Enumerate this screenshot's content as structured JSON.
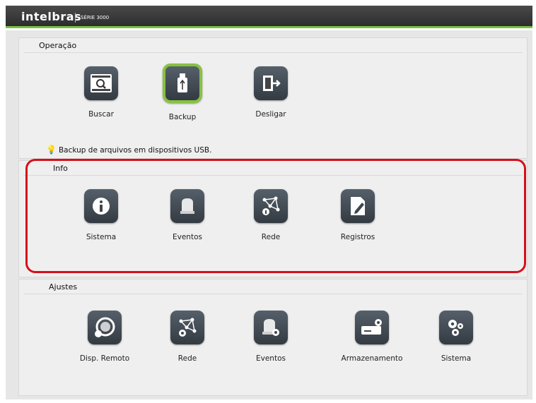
{
  "header": {
    "brand": "intelbras",
    "series": "SÉRIE 3000"
  },
  "operacao": {
    "title": "Operação",
    "items": [
      {
        "label": "Buscar",
        "icon": "search-video-icon"
      },
      {
        "label": "Backup",
        "icon": "usb-drive-icon",
        "selected": true
      },
      {
        "label": "Desligar",
        "icon": "exit-door-icon"
      }
    ],
    "hint": "Backup de arquivos em dispositivos USB."
  },
  "info": {
    "title": "Info",
    "items": [
      {
        "label": "Sistema",
        "icon": "info-icon"
      },
      {
        "label": "Eventos",
        "icon": "alarm-light-icon"
      },
      {
        "label": "Rede",
        "icon": "network-info-icon"
      },
      {
        "label": "Registros",
        "icon": "log-edit-icon"
      }
    ]
  },
  "ajustes": {
    "title": "Ajustes",
    "items": [
      {
        "label": "Disp. Remoto",
        "icon": "remote-camera-icon"
      },
      {
        "label": "Rede",
        "icon": "network-settings-icon"
      },
      {
        "label": "Eventos",
        "icon": "event-settings-icon"
      },
      {
        "label": "Armazenamento",
        "icon": "storage-settings-icon"
      },
      {
        "label": "Sistema",
        "icon": "system-gears-icon"
      }
    ]
  },
  "colors": {
    "accent": "#86c23f",
    "highlight": "#d4101b",
    "icon_bg": "#3e464e"
  }
}
